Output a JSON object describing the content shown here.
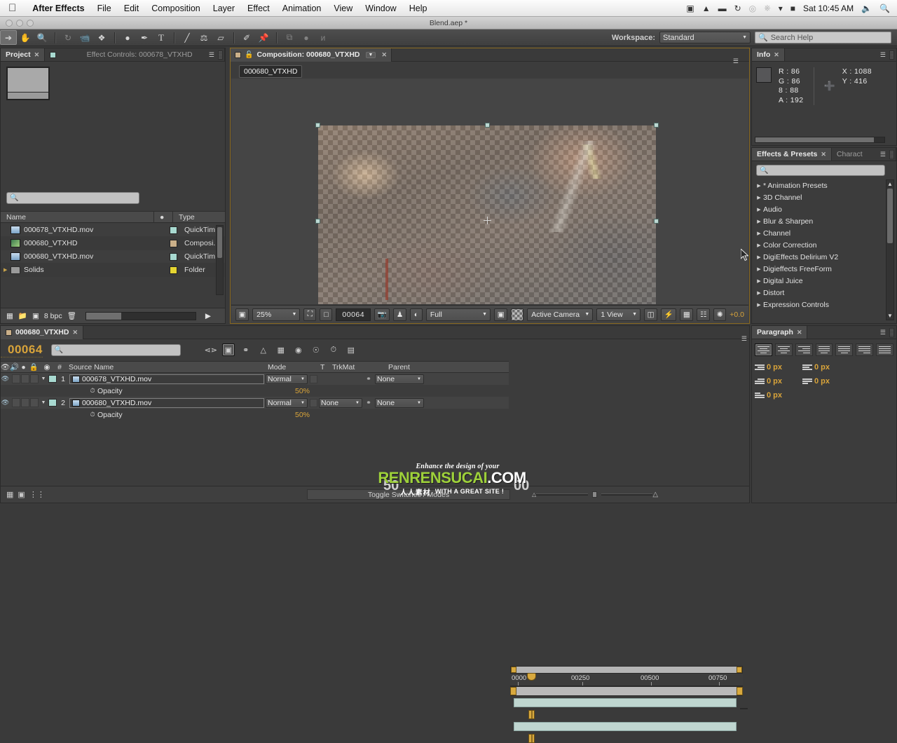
{
  "os": {
    "apple_icon": "apple-logo",
    "menus": [
      "After Effects",
      "File",
      "Edit",
      "Composition",
      "Layer",
      "Effect",
      "Animation",
      "View",
      "Window",
      "Help"
    ],
    "status_icons": [
      "screen-record-icon",
      "airplay-icon",
      "display-icon",
      "sync-icon",
      "airdrop-icon",
      "bluetooth-icon",
      "wifi-icon",
      "battery-icon"
    ],
    "clock": "Sat 10:45 AM",
    "volume_icon": "volume-icon",
    "spotlight_icon": "search-icon"
  },
  "window": {
    "title": "Blend.aep *"
  },
  "toolbar": {
    "tools": [
      {
        "name": "selection-tool",
        "glyph": "↖",
        "selected": true
      },
      {
        "name": "hand-tool",
        "glyph": "✋",
        "selected": false
      },
      {
        "name": "zoom-tool",
        "glyph": "🔍",
        "selected": false
      },
      {
        "name": "rotation-tool",
        "glyph": "↻",
        "selected": false,
        "dim": true
      },
      {
        "name": "camera-tool",
        "glyph": "🎥",
        "selected": false
      },
      {
        "name": "pan-behind-tool",
        "glyph": "✤",
        "selected": false
      },
      {
        "name": "shape-tool",
        "glyph": "●",
        "selected": false
      },
      {
        "name": "pen-tool",
        "glyph": "✒",
        "selected": false
      },
      {
        "name": "type-tool",
        "glyph": "T",
        "selected": false
      },
      {
        "name": "brush-tool",
        "glyph": "╱",
        "selected": false
      },
      {
        "name": "clone-stamp-tool",
        "glyph": "⚗",
        "selected": false
      },
      {
        "name": "eraser-tool",
        "glyph": "▱",
        "selected": false
      },
      {
        "name": "roto-brush-tool",
        "glyph": "✒",
        "selected": false
      },
      {
        "name": "puppet-pin-tool",
        "glyph": "📌",
        "selected": false
      },
      {
        "name": "snapping-toggle",
        "glyph": "⧉",
        "selected": false,
        "dim": true
      },
      {
        "name": "grid-dot-icon",
        "glyph": "●",
        "selected": false,
        "dim": true
      },
      {
        "name": "extra-tool-icon",
        "glyph": "и",
        "selected": false,
        "dim": true
      }
    ],
    "workspace_label": "Workspace:",
    "workspace_value": "Standard",
    "search_help_placeholder": "Search Help"
  },
  "project_panel": {
    "tabs": [
      {
        "label": "Project",
        "active": true,
        "closable": true
      },
      {
        "label": "Effect Controls: 000678_VTXHD",
        "active": false,
        "closable": false
      }
    ],
    "search_placeholder": "",
    "columns": [
      "Name",
      "Type"
    ],
    "items": [
      {
        "name": "000678_VTXHD.mov",
        "type": "QuickTim",
        "color": "#a8d9d0",
        "icon": "movie-icon"
      },
      {
        "name": "000680_VTXHD",
        "type": "Composi.",
        "color": "#cbb089",
        "icon": "composition-icon"
      },
      {
        "name": "000680_VTXHD.mov",
        "type": "QuickTim",
        "color": "#a8d9d0",
        "icon": "movie-icon"
      },
      {
        "name": "Solids",
        "type": "Folder",
        "color": "#e5d531",
        "icon": "folder-icon"
      }
    ],
    "footer": {
      "bit_depth": "8 bpc"
    }
  },
  "comp_panel": {
    "tab_label": "Composition: 000680_VTXHD",
    "comp_name_chip": "000680_VTXHD",
    "footer": {
      "magnification": "25%",
      "timecode": "00064",
      "resolution": "Full",
      "view_layout_camera": "Active Camera",
      "views": "1 View",
      "exposure": "+0.0"
    }
  },
  "info_panel": {
    "tab_label": "Info",
    "R": "R : 86",
    "G": "G : 86",
    "B": "8 : 88",
    "A": "A : 192",
    "X": "X : 1088",
    "Y": "Y : 416"
  },
  "effects_panel": {
    "tabs": [
      {
        "label": "Effects & Presets",
        "active": true
      },
      {
        "label": "Charact",
        "active": false
      }
    ],
    "search_placeholder": "",
    "categories": [
      "* Animation Presets",
      "3D Channel",
      "Audio",
      "Blur & Sharpen",
      "Channel",
      "Color Correction",
      "DigiEffects Delirium V2",
      "Digieffects FreeForm",
      "Digital Juice",
      "Distort",
      "Expression Controls"
    ]
  },
  "paragraph_panel": {
    "tab_label": "Paragraph",
    "align_buttons": [
      "align-left",
      "align-center",
      "align-right",
      "justify-last-left",
      "justify-last-center",
      "justify-last-right",
      "justify-all"
    ],
    "fields": [
      {
        "icon": "indent-left-icon",
        "value": "0 px"
      },
      {
        "icon": "indent-right-icon",
        "value": "0 px"
      },
      {
        "icon": "first-line-indent-icon",
        "value": "0 px"
      },
      {
        "icon": "space-before-icon",
        "value": "0 px"
      },
      {
        "icon": "space-after-icon",
        "value": "0 px"
      }
    ]
  },
  "timeline_panel": {
    "tab_label": "000680_VTXHD",
    "current_time": "00064",
    "search_placeholder": "",
    "columns": [
      "Source Name",
      "Mode",
      "T",
      "TrkMat",
      "Parent"
    ],
    "layers": [
      {
        "index": "1",
        "source_name": "000678_VTXHD.mov",
        "mode": "Normal",
        "trkmat": "",
        "parent": "None",
        "property": "Opacity",
        "property_value": "50%",
        "color": "#a8d9d0"
      },
      {
        "index": "2",
        "source_name": "000680_VTXHD.mov",
        "mode": "Normal",
        "trkmat": "None",
        "parent": "None",
        "property": "Opacity",
        "property_value": "50%",
        "color": "#a8d9d0"
      }
    ],
    "ruler_ticks": [
      "0000",
      "00250",
      "00500",
      "00750"
    ],
    "toggle_switches_label": "Toggle Switches / Modes"
  },
  "watermark": {
    "line1": "Enhance the design of your",
    "domain_green": "RENRENSUCAI",
    "domain_white": ".COM",
    "chinese": "人人素材",
    "tagline": "WITH A GREAT SITE !"
  }
}
